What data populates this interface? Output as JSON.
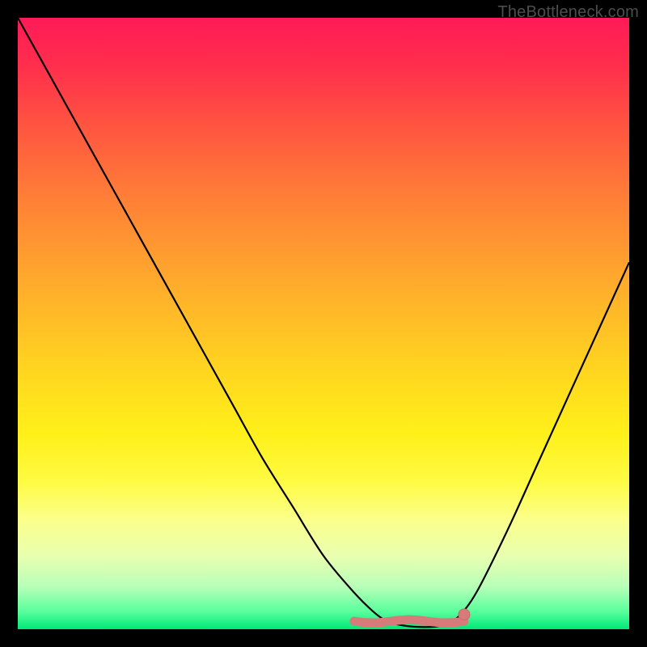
{
  "watermark": "TheBottleneck.com",
  "colors": {
    "curve": "#000000",
    "marker_fill": "#d67a7a",
    "marker_stroke": "#c96a6a"
  },
  "chart_data": {
    "type": "line",
    "title": "",
    "xlabel": "",
    "ylabel": "",
    "xlim": [
      0,
      100
    ],
    "ylim": [
      0,
      100
    ],
    "series": [
      {
        "name": "bottleneck-curve",
        "x": [
          0,
          5,
          10,
          15,
          20,
          25,
          30,
          35,
          40,
          45,
          50,
          55,
          58,
          60,
          62,
          65,
          68,
          70,
          72,
          75,
          80,
          85,
          90,
          95,
          100
        ],
        "y": [
          100,
          91,
          82,
          73,
          64,
          55,
          46,
          37,
          28,
          20,
          12,
          6,
          3,
          1.5,
          0.8,
          0.4,
          0.4,
          0.8,
          2,
          6,
          16,
          27,
          38,
          49,
          60
        ]
      }
    ],
    "flat_region": {
      "x_start": 55,
      "x_end": 73,
      "y": 1.3
    },
    "marker": {
      "x": 73,
      "y": 2.4
    }
  }
}
